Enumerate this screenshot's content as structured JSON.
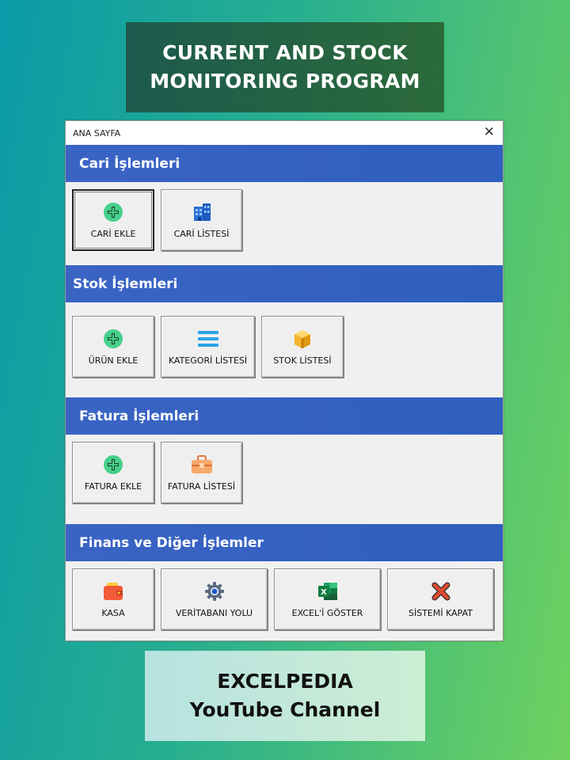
{
  "banner_top": {
    "line1": "CURRENT AND STOCK",
    "line2": "MONITORING PROGRAM"
  },
  "window": {
    "title": "ANA SAYFA",
    "close_glyph": "✕"
  },
  "sections": {
    "cari": {
      "title": "Cari İşlemleri"
    },
    "stok": {
      "title": "Stok İşlemleri"
    },
    "fatura": {
      "title": "Fatura İşlemleri"
    },
    "finans": {
      "title": "Finans ve Diğer İşlemler"
    }
  },
  "buttons": {
    "cari_ekle": {
      "label": "CARİ EKLE",
      "icon": "plus-circle-icon"
    },
    "cari_listesi": {
      "label": "CARİ LİSTESİ",
      "icon": "building-icon"
    },
    "urun_ekle": {
      "label": "ÜRÜN EKLE",
      "icon": "plus-circle-icon"
    },
    "kategori_listesi": {
      "label": "KATEGORİ LİSTESİ",
      "icon": "list-icon"
    },
    "stok_listesi": {
      "label": "STOK LİSTESİ",
      "icon": "box-icon"
    },
    "fatura_ekle": {
      "label": "FATURA EKLE",
      "icon": "plus-circle-icon"
    },
    "fatura_listesi": {
      "label": "FATURA LİSTESİ",
      "icon": "toolbox-icon"
    },
    "kasa": {
      "label": "KASA",
      "icon": "wallet-icon"
    },
    "veritabani_yolu": {
      "label": "VERİTABANI YOLU",
      "icon": "gear-icon"
    },
    "excel_goster": {
      "label": "EXCEL'İ GÖSTER",
      "icon": "excel-icon"
    },
    "sistemi_kapat": {
      "label": "SİSTEMİ KAPAT",
      "icon": "x-mark-icon"
    }
  },
  "banner_bottom": {
    "line1": "EXCELPEDIA",
    "line2": "YouTube Channel"
  },
  "colors": {
    "header_blue": "#3a64c4",
    "plus_green": "#45d08a",
    "close_red": "#e04a2f"
  }
}
